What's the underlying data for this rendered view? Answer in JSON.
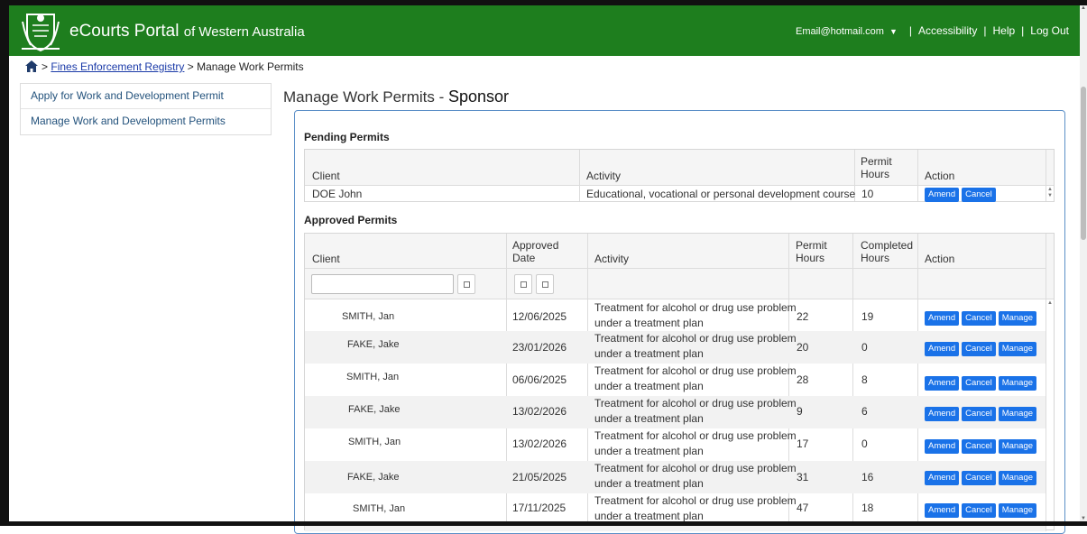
{
  "header": {
    "brand_main": "eCourts Portal",
    "brand_sub": "of Western Australia",
    "email": "Email@hotmail.com",
    "accessibility": "Accessibility",
    "help": "Help",
    "logout": "Log Out",
    "color": "#1e7e1e"
  },
  "breadcrumb": {
    "separator": ">",
    "registry": "Fines Enforcement Registry",
    "current": "Manage Work Permits"
  },
  "sidenav": {
    "items": [
      {
        "label": "Apply for Work and Development Permit"
      },
      {
        "label": "Manage Work and Development Permits"
      }
    ]
  },
  "page": {
    "title": "Manage Work Permits -",
    "role": "Sponsor"
  },
  "pending": {
    "title": "Pending Permits",
    "headers": {
      "client": "Client",
      "activity": "Activity",
      "hours_1": "Permit",
      "hours_2": "Hours",
      "action": "Action"
    },
    "rows": [
      {
        "client": "DOE John",
        "activity": "Educational, vocational or personal development course",
        "hours": "10"
      }
    ]
  },
  "approved": {
    "title": "Approved Permits",
    "headers": {
      "client": "Client",
      "date_1": "Approved",
      "date_2": "Date",
      "activity": "Activity",
      "hours_1": "Permit",
      "hours_2": "Hours",
      "completed_1": "Completed",
      "completed_2": "Hours",
      "action": "Action"
    },
    "rows": [
      {
        "client": "SMITH, Jan",
        "date": "12/06/2025",
        "activity_1": "Treatment for alcohol or drug use problem",
        "activity_2": "under a treatment plan",
        "hours": "22",
        "completed": "19"
      },
      {
        "client": "FAKE, Jake",
        "date": "23/01/2026",
        "activity_1": "Treatment for alcohol or drug use problem",
        "activity_2": "under a treatment plan",
        "hours": "20",
        "completed": "0"
      },
      {
        "client": "SMITH, Jan",
        "date": "06/06/2025",
        "activity_1": "Treatment for alcohol or drug use problem",
        "activity_2": "under a treatment plan",
        "hours": "28",
        "completed": "8"
      },
      {
        "client": "FAKE, Jake",
        "date": "13/02/2026",
        "activity_1": "Treatment for alcohol or drug use problem",
        "activity_2": "under a treatment plan",
        "hours": "9",
        "completed": "6"
      },
      {
        "client": "SMITH, Jan",
        "date": "13/02/2026",
        "activity_1": "Treatment for alcohol or drug use problem",
        "activity_2": "under a treatment plan",
        "hours": "17",
        "completed": "0"
      },
      {
        "client": "FAKE, Jake",
        "date": "21/05/2025",
        "activity_1": "Treatment for alcohol or drug use problem",
        "activity_2": "under a treatment plan",
        "hours": "31",
        "completed": "16"
      },
      {
        "client": "SMITH, Jan",
        "date": "17/11/2025",
        "activity_1": "Treatment for alcohol or drug use problem",
        "activity_2": "under a treatment plan",
        "hours": "47",
        "completed": "18"
      }
    ]
  },
  "buttons": {
    "amend": "Amend",
    "cancel": "Cancel",
    "manage": "Manage",
    "color": "#1a72e8"
  }
}
